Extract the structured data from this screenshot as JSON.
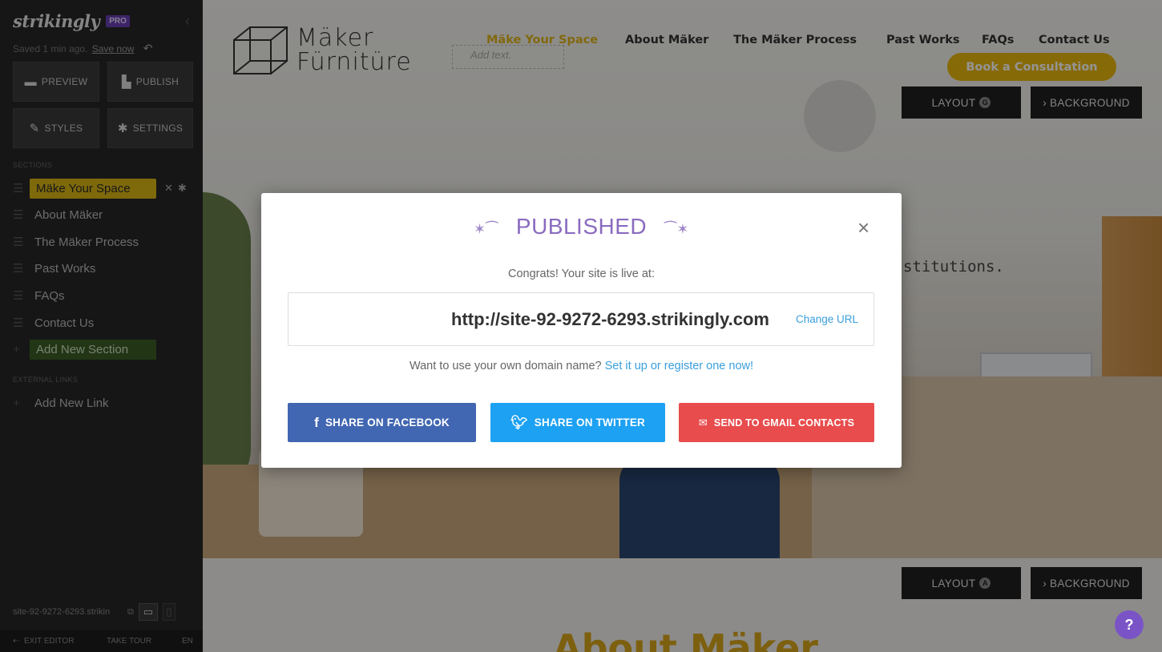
{
  "sidebar": {
    "logo": "strikingly",
    "pro_badge": "PRO",
    "collapse_glyph": "‹",
    "saved_text": "Saved 1 min ago.",
    "save_now": "Save now",
    "buttons": {
      "preview": "PREVIEW",
      "publish": "PUBLISH",
      "styles": "STYLES",
      "settings": "SETTINGS"
    },
    "sections_heading": "SECTIONS",
    "sections": [
      {
        "label": "Mäke Your Space"
      },
      {
        "label": "About Mäker"
      },
      {
        "label": "The Mäker Process"
      },
      {
        "label": "Past Works"
      },
      {
        "label": "FAQs"
      },
      {
        "label": "Contact Us"
      }
    ],
    "add_section": "Add New Section",
    "external_heading": "EXTERNAL LINKS",
    "add_link": "Add New Link",
    "site_url": "site-92-9272-6293.strikin",
    "footer": {
      "exit": "EXIT EDITOR",
      "tour": "TAKE TOUR",
      "lang": "EN"
    }
  },
  "site": {
    "logo_line1": "Mäker",
    "logo_line2": "Fürnitüre",
    "add_text_placeholder": "Add text.",
    "nav": [
      {
        "label": "Mäke Your Space"
      },
      {
        "label": "About Mäker"
      },
      {
        "label": "The Mäker Process"
      },
      {
        "label": "Past Works"
      },
      {
        "label": "FAQs"
      },
      {
        "label": "Contact Us"
      }
    ],
    "cta": "Book a Consultation",
    "hero_text": "stitutions.",
    "section2_heading": "About Mäker",
    "help": "?"
  },
  "editor": {
    "layout_label": "LAYOUT",
    "layout_badge_top": "G",
    "layout_badge_bottom": "A",
    "background_label": "› BACKGROUND"
  },
  "modal": {
    "title": "PUBLISHED",
    "close": "×",
    "congrats": "Congrats! Your site is live at:",
    "url": "http://site-92-9272-6293.strikingly.com",
    "change_url": "Change URL",
    "own_domain_text": "Want to use your own domain name?",
    "own_domain_link": "Set it up or register one now!",
    "share_facebook": "SHARE ON FACEBOOK",
    "share_twitter": "SHARE ON TWITTER",
    "share_gmail": "SEND TO GMAIL CONTACTS"
  },
  "colors": {
    "accent_yellow": "#d9b513",
    "pro_purple": "#6a3fb3",
    "modal_title": "#8a6bbf",
    "link_blue": "#3a9fdd",
    "facebook": "#4267b2",
    "twitter": "#1da1f2",
    "gmail": "#e84c4c"
  }
}
